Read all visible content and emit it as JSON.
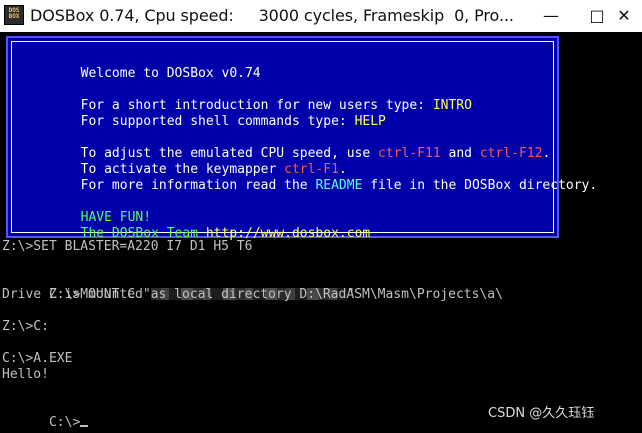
{
  "window": {
    "title": "DOSBox 0.74, Cpu speed:     3000 cycles, Frameskip  0, Pro...",
    "icon_label_top": "DOS",
    "icon_label_bottom": "BOX",
    "minimize_glyph": "—",
    "maximize_glyph": "□",
    "close_glyph": "✕"
  },
  "banner": {
    "welcome": "Welcome to DOSBox v0.74",
    "intro_prefix": "For a short introduction for new users type: ",
    "intro_cmd": "INTRO",
    "help_prefix": "For supported shell commands type: ",
    "help_cmd": "HELP",
    "cpu_prefix": "To adjust the emulated CPU speed, use ",
    "cpu_key1": "ctrl-F11",
    "cpu_and": " and ",
    "cpu_key2": "ctrl-F12",
    "cpu_suffix": ".",
    "keymap_prefix": "To activate the keymapper ",
    "keymap_key": "ctrl-F1",
    "keymap_suffix": ".",
    "readme_prefix": "For more information read the ",
    "readme_word": "README",
    "readme_suffix": " file in the DOSBox directory.",
    "have_fun": "HAVE FUN!",
    "team": "The DOSBox Team ",
    "url": "http://www.dosbox.com"
  },
  "terminal": {
    "line_set_blaster": "Z:\\>SET BLASTER=A220 I7 D1 H5 T6",
    "line_mount_prefix": "Z:\\>MOUNT C \"",
    "line_mount_suffix": "\"",
    "line_mounted": "Drive C is mounted as local directory D:\\RadASM\\Masm\\Projects\\a\\",
    "line_cd": "Z:\\>C:",
    "line_run": "C:\\>A.EXE",
    "line_output": "Hello!",
    "line_prompt": "C:\\>"
  },
  "watermark": "CSDN @久久珏钰",
  "colors": {
    "banner_bg": "#0000aa",
    "banner_text": "#ffffff",
    "command_highlight": "#ffff55",
    "key_highlight": "#ff5555",
    "readme_highlight": "#55ffff",
    "fun_text": "#55ff55",
    "terminal_text": "#c0c0c0"
  }
}
